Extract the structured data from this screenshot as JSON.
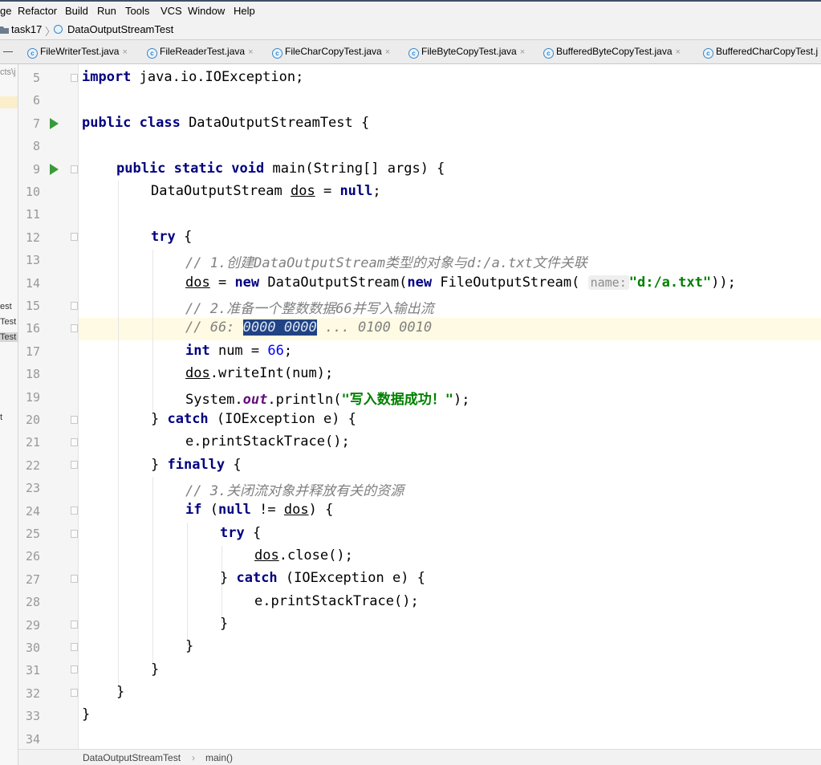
{
  "menu": [
    "ge",
    "Refactor",
    "Build",
    "Run",
    "Tools",
    "VCS",
    "Window",
    "Help"
  ],
  "breadcrumb": {
    "folder": "task17",
    "file": "DataOutputStreamTest"
  },
  "tabs": [
    "FileWriterTest.java",
    "FileReaderTest.java",
    "FileCharCopyTest.java",
    "FileByteCopyTest.java",
    "BufferedByteCopyTest.java",
    "BufferedCharCopyTest.j"
  ],
  "project_strip": {
    "top": "cts\\j",
    "items": [
      "est",
      "Test",
      "Test",
      "t"
    ]
  },
  "line_numbers": [
    "5",
    "6",
    "7",
    "8",
    "9",
    "10",
    "11",
    "12",
    "13",
    "14",
    "15",
    "16",
    "17",
    "18",
    "19",
    "20",
    "21",
    "22",
    "23",
    "24",
    "25",
    "26",
    "27",
    "28",
    "29",
    "30",
    "31",
    "32",
    "33",
    "34"
  ],
  "code": {
    "l5": {
      "kw": "import",
      "rest": " java.io.IOException;"
    },
    "l7": {
      "kw": "public class",
      "rest": " DataOutputStreamTest {"
    },
    "l9": {
      "kw": "public static void",
      "rest": " main(String[] args) {"
    },
    "l10": {
      "a": "DataOutputStream ",
      "var": "dos",
      "b": " = ",
      "kw": "null",
      "c": ";"
    },
    "l12": {
      "kw": "try",
      "rest": " {"
    },
    "l13": "// 1.创建DataOutputStream类型的对象与d:/a.txt文件关联",
    "l14": {
      "var": "dos",
      "a": " = ",
      "kw1": "new",
      "b": " DataOutputStream(",
      "kw2": "new",
      "c": " FileOutputStream( ",
      "hint": "name:",
      "str": "\"d:/a.txt\"",
      "d": "));"
    },
    "l15": "// 2.准备一个整数数据66并写入输出流",
    "l16": {
      "pre": "// 66: ",
      "sel": "0000 0000",
      "post": " ... 0100 0010"
    },
    "l17": {
      "kw": "int",
      "a": " num = ",
      "num": "66",
      "b": ";"
    },
    "l18": {
      "var": "dos",
      "rest": ".writeInt(num);"
    },
    "l19": {
      "a": "System.",
      "field": "out",
      "b": ".println(",
      "str": "\"写入数据成功！\"",
      "c": ");"
    },
    "l20": {
      "a": "} ",
      "kw": "catch",
      "b": " (IOException e) {"
    },
    "l21": "e.printStackTrace();",
    "l22": {
      "a": "} ",
      "kw": "finally",
      "b": " {"
    },
    "l23": "// 3.关闭流对象并释放有关的资源",
    "l24": {
      "kw1": "if",
      "a": " (",
      "kw2": "null",
      "b": " != ",
      "var": "dos",
      "c": ") {"
    },
    "l25": {
      "kw": "try",
      "rest": " {"
    },
    "l26": {
      "var": "dos",
      "rest": ".close();"
    },
    "l27": {
      "a": "} ",
      "kw": "catch",
      "b": " (IOException e) {"
    },
    "l28": "e.printStackTrace();",
    "brace": "}"
  },
  "status": {
    "class": "DataOutputStreamTest",
    "method": "main()",
    "sep": "›"
  },
  "icons": {
    "tab": "class-file-icon",
    "folder": "folder-icon",
    "run": "run-gutter-icon",
    "fold": "fold-marker-icon"
  },
  "colors": {
    "keyword": "#000080",
    "string": "#008000",
    "number": "#0000ff",
    "comment": "#808080",
    "selection": "#214283",
    "caret_row": "#fffae3"
  }
}
